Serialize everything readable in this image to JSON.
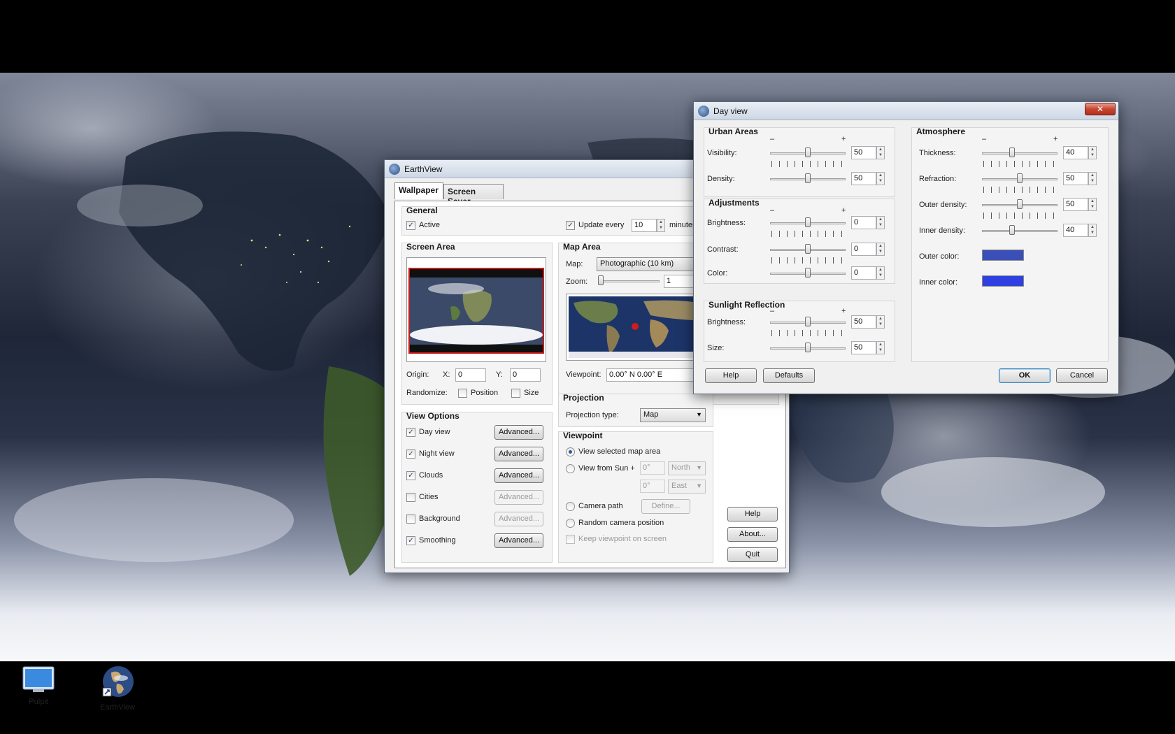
{
  "desktop": {
    "icons": [
      {
        "label": "Pulpit"
      },
      {
        "label": "EarthView"
      }
    ]
  },
  "earthview": {
    "title": "EarthView",
    "tabs": [
      {
        "label": "Wallpaper"
      },
      {
        "label": "Screen Saver"
      }
    ],
    "general": {
      "title": "General",
      "active_label": "Active",
      "update_label": "Update every",
      "update_value": "10",
      "update_unit": "minutes"
    },
    "screen_area": {
      "title": "Screen Area",
      "origin_label": "Origin:",
      "x_label": "X:",
      "x_value": "0",
      "y_label": "Y:",
      "y_value": "0",
      "randomize_label": "Randomize:",
      "position_label": "Position",
      "size_label": "Size"
    },
    "map_area": {
      "title": "Map Area",
      "map_label": "Map:",
      "map_value": "Photographic (10 km)",
      "zoom_label": "Zoom:",
      "zoom_value": "1",
      "viewpoint_label": "Viewpoint:",
      "viewpoint_value": "0.00° N   0.00° E"
    },
    "view_options": {
      "title": "View Options",
      "items": [
        {
          "label": "Day view",
          "checked": true,
          "button": "Advanced..."
        },
        {
          "label": "Night view",
          "checked": true,
          "button": "Advanced..."
        },
        {
          "label": "Clouds",
          "checked": true,
          "button": "Advanced..."
        },
        {
          "label": "Cities",
          "checked": false,
          "button": "Advanced..."
        },
        {
          "label": "Background",
          "checked": false,
          "button": "Advanced..."
        },
        {
          "label": "Smoothing",
          "checked": true,
          "button": "Advanced..."
        }
      ]
    },
    "projection": {
      "title": "Projection",
      "type_label": "Projection type:",
      "type_value": "Map"
    },
    "viewpoint": {
      "title": "Viewpoint",
      "selected_map_area": "View selected map area",
      "from_sun": "View from Sun +",
      "lat_value": "0°",
      "lat_dir": "North",
      "lon_value": "0°",
      "lon_dir": "East",
      "camera_path": "Camera path",
      "define_button": "Define...",
      "random_camera": "Random camera position",
      "keep_viewpoint": "Keep viewpoint on screen"
    },
    "buttons": {
      "help": "Help",
      "about": "About...",
      "quit": "Quit"
    }
  },
  "dayview": {
    "title": "Day view",
    "close": "✕",
    "minus": "–",
    "plus": "+",
    "urban": {
      "title": "Urban Areas",
      "visibility_label": "Visibility:",
      "visibility_value": "50",
      "density_label": "Density:",
      "density_value": "50"
    },
    "adjustments": {
      "title": "Adjustments",
      "brightness_label": "Brightness:",
      "brightness_value": "0",
      "contrast_label": "Contrast:",
      "contrast_value": "0",
      "color_label": "Color:",
      "color_value": "0"
    },
    "sunlight": {
      "title": "Sunlight Reflection",
      "brightness_label": "Brightness:",
      "brightness_value": "50",
      "size_label": "Size:",
      "size_value": "50"
    },
    "atmosphere": {
      "title": "Atmosphere",
      "thickness_label": "Thickness:",
      "thickness_value": "40",
      "refraction_label": "Refraction:",
      "refraction_value": "50",
      "outer_density_label": "Outer density:",
      "outer_density_value": "50",
      "inner_density_label": "Inner density:",
      "inner_density_value": "40",
      "outer_color_label": "Outer color:",
      "outer_color": "#3a4fb8",
      "inner_color_label": "Inner color:",
      "inner_color": "#2f3fe0"
    },
    "buttons": {
      "help": "Help",
      "defaults": "Defaults",
      "ok": "OK",
      "cancel": "Cancel"
    }
  }
}
